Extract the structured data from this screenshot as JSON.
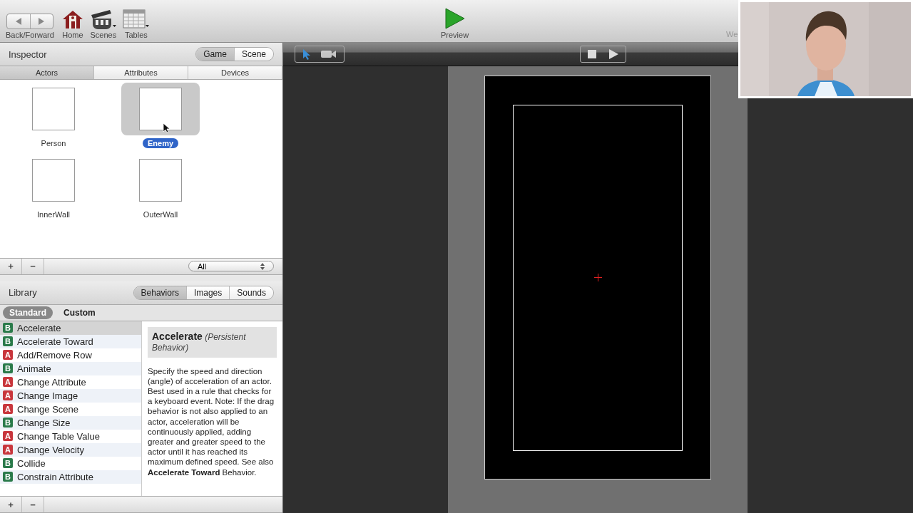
{
  "toolbar": {
    "nav": {
      "label": "Back/Forward"
    },
    "items": [
      {
        "kind": "home",
        "label": "Home"
      },
      {
        "kind": "scenes",
        "label": "Scenes"
      },
      {
        "kind": "tables",
        "label": "Tables"
      }
    ],
    "preview": {
      "label": "Preview"
    },
    "cut_text": "We"
  },
  "inspector": {
    "title": "Inspector",
    "modes": [
      {
        "label": "Game",
        "selected": true
      },
      {
        "label": "Scene",
        "selected": false
      }
    ],
    "tabs": [
      {
        "label": "Actors",
        "selected": true
      },
      {
        "label": "Attributes",
        "selected": false
      },
      {
        "label": "Devices",
        "selected": false
      }
    ],
    "actors": [
      {
        "name": "Person",
        "selected": false
      },
      {
        "name": "Enemy",
        "selected": true
      },
      {
        "name": "InnerWall",
        "selected": false
      },
      {
        "name": "OuterWall",
        "selected": false
      }
    ],
    "footer": {
      "add": "+",
      "remove": "−",
      "filter": "All"
    }
  },
  "library": {
    "title": "Library",
    "tabs": [
      {
        "label": "Behaviors",
        "selected": true
      },
      {
        "label": "Images",
        "selected": false
      },
      {
        "label": "Sounds",
        "selected": false
      }
    ],
    "subtabs": [
      {
        "label": "Standard",
        "selected": true
      },
      {
        "label": "Custom",
        "selected": false
      }
    ],
    "behaviors": [
      {
        "kind": "behavior",
        "badge": "B",
        "name": "Accelerate",
        "selected": true
      },
      {
        "kind": "behavior",
        "badge": "B",
        "name": "Accelerate Toward",
        "selected": false
      },
      {
        "kind": "action",
        "badge": "A",
        "name": "Add/Remove Row",
        "selected": false
      },
      {
        "kind": "behavior",
        "badge": "B",
        "name": "Animate",
        "selected": false
      },
      {
        "kind": "action",
        "badge": "A",
        "name": "Change Attribute",
        "selected": false
      },
      {
        "kind": "action",
        "badge": "A",
        "name": "Change Image",
        "selected": false
      },
      {
        "kind": "action",
        "badge": "A",
        "name": "Change Scene",
        "selected": false
      },
      {
        "kind": "behavior",
        "badge": "B",
        "name": "Change Size",
        "selected": false
      },
      {
        "kind": "action",
        "badge": "A",
        "name": "Change Table Value",
        "selected": false
      },
      {
        "kind": "action",
        "badge": "A",
        "name": "Change Velocity",
        "selected": false
      },
      {
        "kind": "behavior",
        "badge": "B",
        "name": "Collide",
        "selected": false
      },
      {
        "kind": "behavior",
        "badge": "B",
        "name": "Constrain Attribute",
        "selected": false
      }
    ],
    "description": {
      "title": "Accelerate",
      "subtitle": "(Persistent Behavior)",
      "body": "Specify the speed and direction (angle) of acceleration of an actor. Best used in a rule that checks for a keyboard event. Note: If the drag behavior is not also applied to an actor, acceleration will be continuously applied, adding greater and greater speed to the actor until it has reached its maximum defined speed. See also **Accelerate Toward** Behavior."
    },
    "footer": {
      "add": "+",
      "remove": "−"
    }
  },
  "scene": {
    "tools": [
      {
        "kind": "arrow",
        "selected": true
      },
      {
        "kind": "camera",
        "selected": false
      }
    ],
    "playback": [
      {
        "kind": "stop"
      },
      {
        "kind": "play"
      }
    ]
  }
}
